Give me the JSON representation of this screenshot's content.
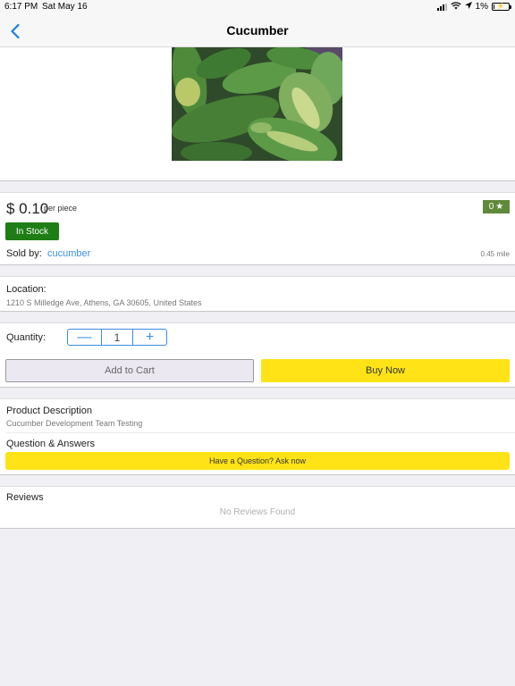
{
  "status_bar": {
    "time": "6:17 PM",
    "date": "Sat May 16",
    "battery": "1%",
    "icons": [
      "signal-icon",
      "wifi-icon",
      "location-arrow-icon",
      "battery-charging-icon"
    ]
  },
  "nav": {
    "title": "Cucumber",
    "back_icon": "chevron-left-icon"
  },
  "product": {
    "image_alt": "cucumber-photo",
    "price": "$ 0.10",
    "price_unit": "per piece",
    "rating": "0",
    "rating_icon": "star-icon",
    "stock_label": "In Stock",
    "sold_by_label": "Sold by:",
    "seller": "cucumber",
    "distance": "0.45 mile"
  },
  "location": {
    "label": "Location:",
    "address": "1210 S Milledge Ave, Athens, GA  30605, United States"
  },
  "cart": {
    "quantity_label": "Quantity:",
    "quantity": "1",
    "decrement_symbol": "—",
    "increment_symbol": "+",
    "add_to_cart_label": "Add to Cart",
    "buy_now_label": "Buy Now"
  },
  "description": {
    "title": "Product Description",
    "body": "Cucumber Development Team Testing",
    "qa_title": "Question & Answers",
    "ask_label": "Have a Question? Ask now"
  },
  "reviews": {
    "title": "Reviews",
    "empty_text": "No Reviews Found"
  },
  "colors": {
    "accent_blue": "#3a8ee0",
    "buy_yellow": "#ffe316",
    "in_stock_green": "#1e7d14",
    "rating_green": "#5f8a3b",
    "background": "#efeff4"
  }
}
